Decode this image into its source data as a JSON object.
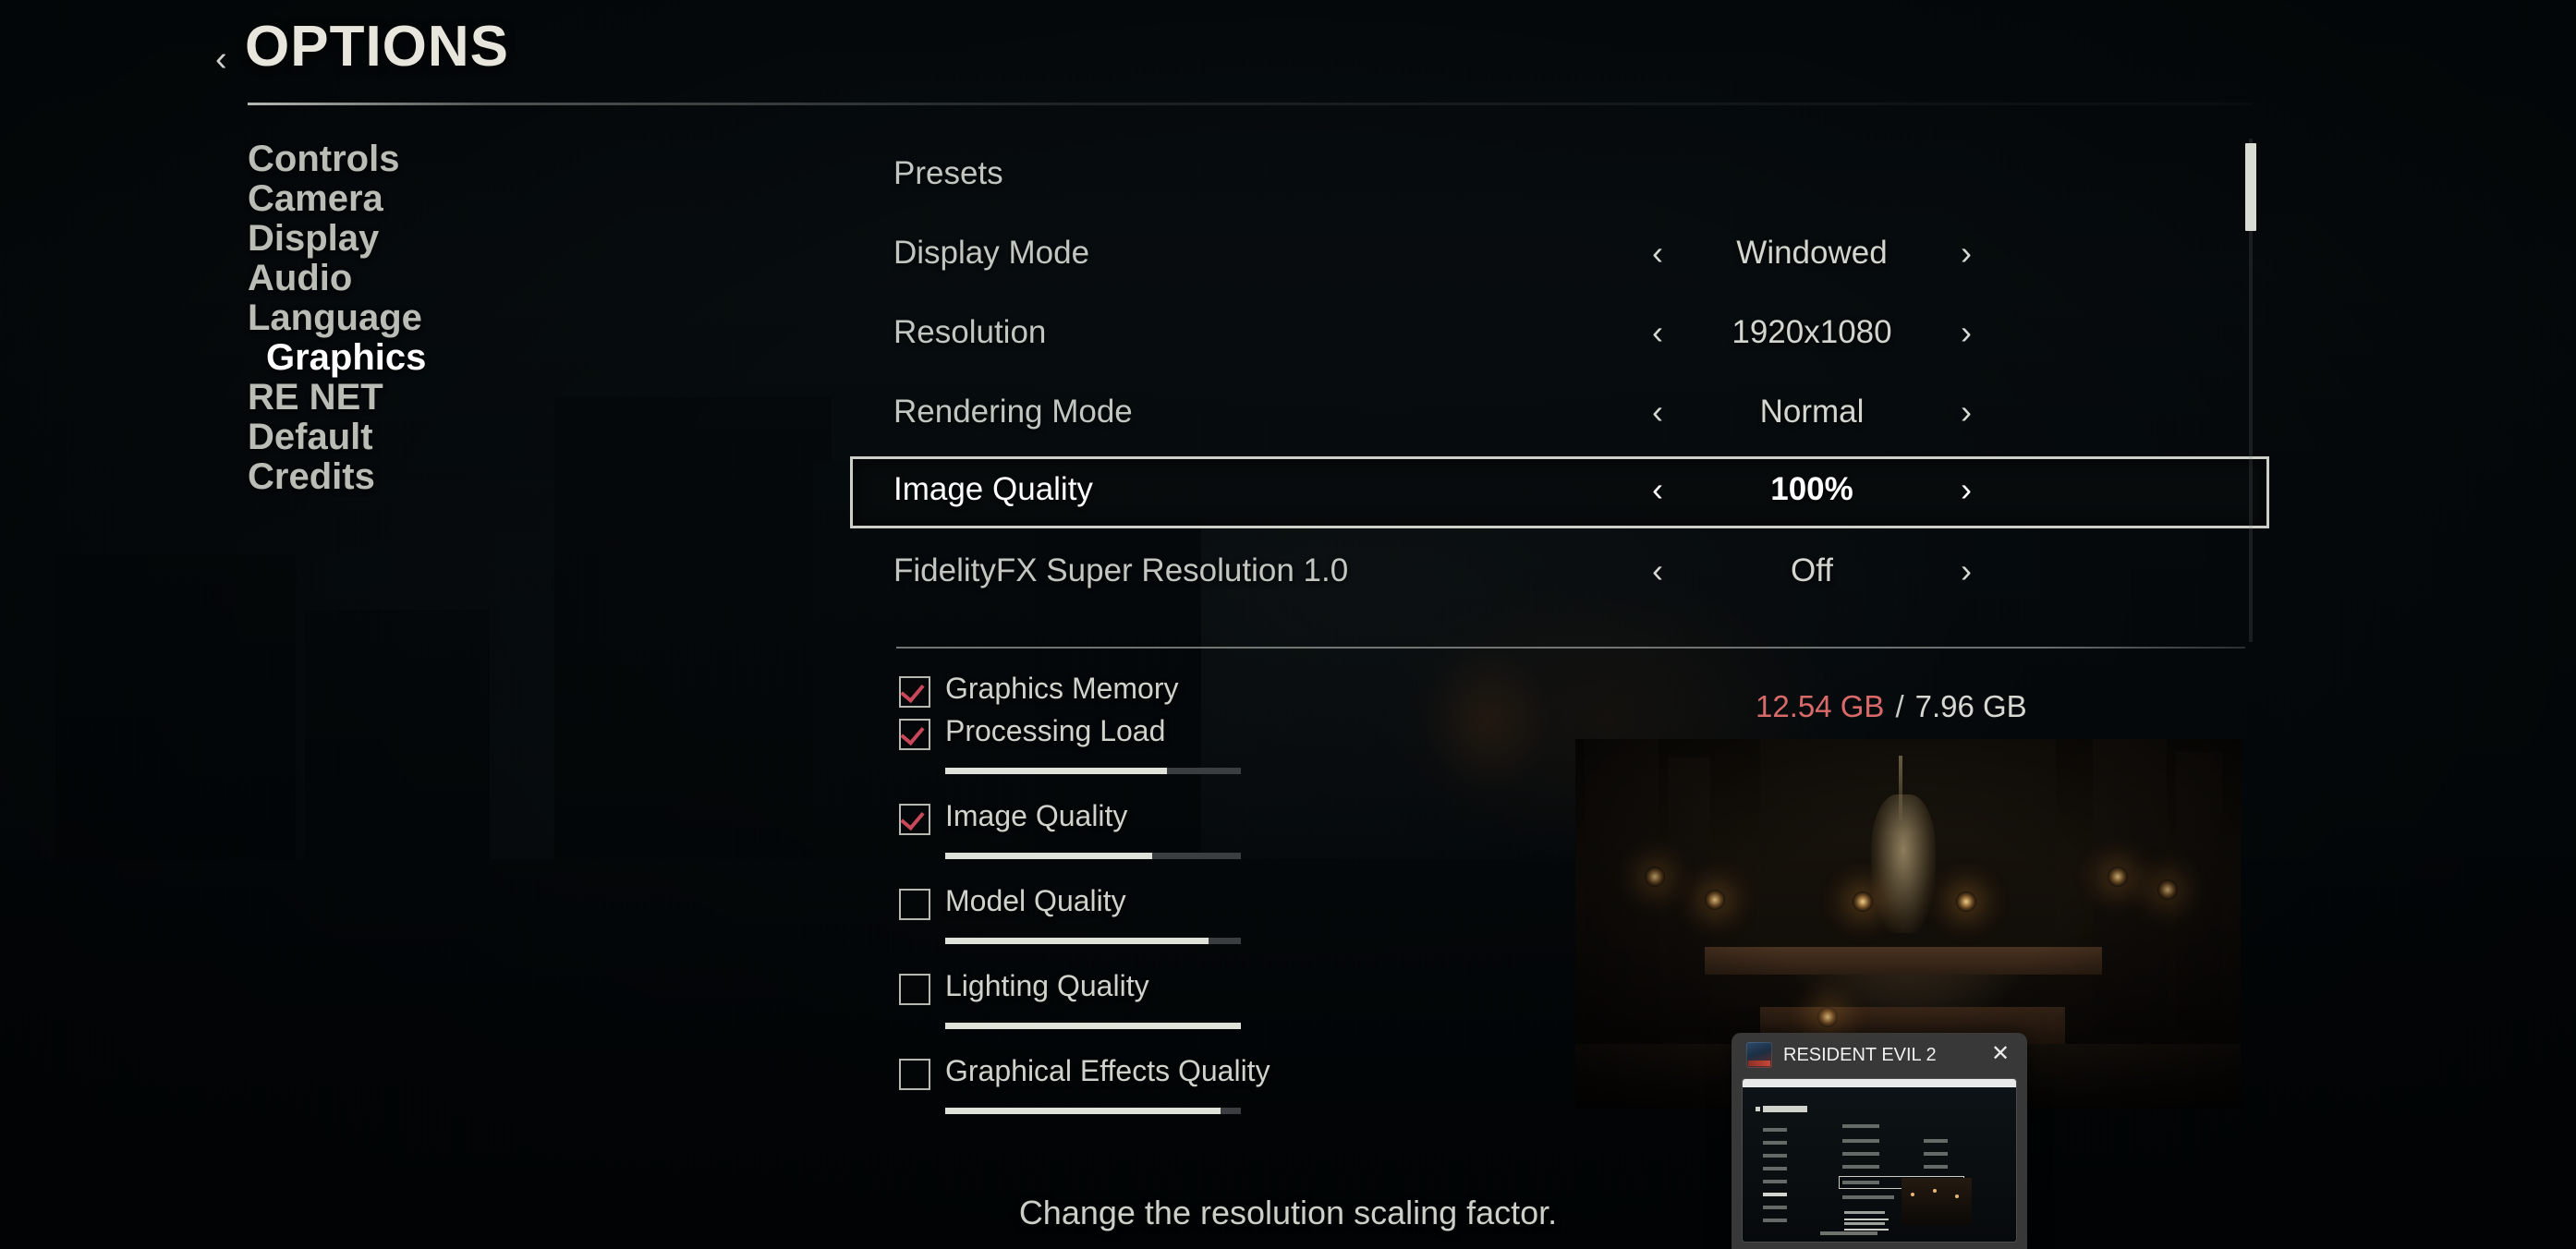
{
  "header": {
    "back_icon": "chevron-left-icon",
    "back_glyph": "‹",
    "title": "OPTIONS"
  },
  "sidebar": {
    "items": [
      {
        "label": "Controls",
        "active": false
      },
      {
        "label": "Camera",
        "active": false
      },
      {
        "label": "Display",
        "active": false
      },
      {
        "label": "Audio",
        "active": false
      },
      {
        "label": "Language",
        "active": false
      },
      {
        "label": "Graphics",
        "active": true
      },
      {
        "label": "RE NET",
        "active": false
      },
      {
        "label": "Default",
        "active": false
      },
      {
        "label": "Credits",
        "active": false
      }
    ]
  },
  "settings": {
    "prev_glyph": "‹",
    "next_glyph": "›",
    "rows": [
      {
        "label": "Presets",
        "value": "",
        "has_arrows": false,
        "selected": false
      },
      {
        "label": "Display Mode",
        "value": "Windowed",
        "has_arrows": true,
        "selected": false
      },
      {
        "label": "Resolution",
        "value": "1920x1080",
        "has_arrows": true,
        "selected": false
      },
      {
        "label": "Rendering Mode",
        "value": "Normal",
        "has_arrows": true,
        "selected": false
      },
      {
        "label": "Image Quality",
        "value": "100%",
        "has_arrows": true,
        "selected": true
      },
      {
        "label": "FidelityFX Super Resolution 1.0",
        "value": "Off",
        "has_arrows": true,
        "selected": false
      }
    ]
  },
  "memory": {
    "used": "12.54 GB",
    "separator": "/",
    "total": "7.96 GB",
    "used_color": "#d96a6a",
    "total_color": "#d5d9d2"
  },
  "checklist": {
    "items": [
      {
        "label": "Graphics Memory",
        "checked": true,
        "meter": null
      },
      {
        "label": "Processing Load",
        "checked": true,
        "meter": 75
      },
      {
        "label": "Image Quality",
        "checked": true,
        "meter": 70
      },
      {
        "label": "Model Quality",
        "checked": false,
        "meter": 89
      },
      {
        "label": "Lighting Quality",
        "checked": false,
        "meter": 100
      },
      {
        "label": "Graphical Effects Quality",
        "checked": false,
        "meter": 93
      }
    ],
    "check_color": "#c8485a"
  },
  "preview": {
    "name": "graphics-preview-image"
  },
  "thumbnail_popup": {
    "app_icon": "resident-evil-2-app-icon",
    "title": "RESIDENT EVIL 2",
    "close_glyph": "✕"
  },
  "footer": {
    "description": "Change the resolution scaling factor."
  },
  "scrollbar": {
    "thumb_position_percent": 2
  }
}
